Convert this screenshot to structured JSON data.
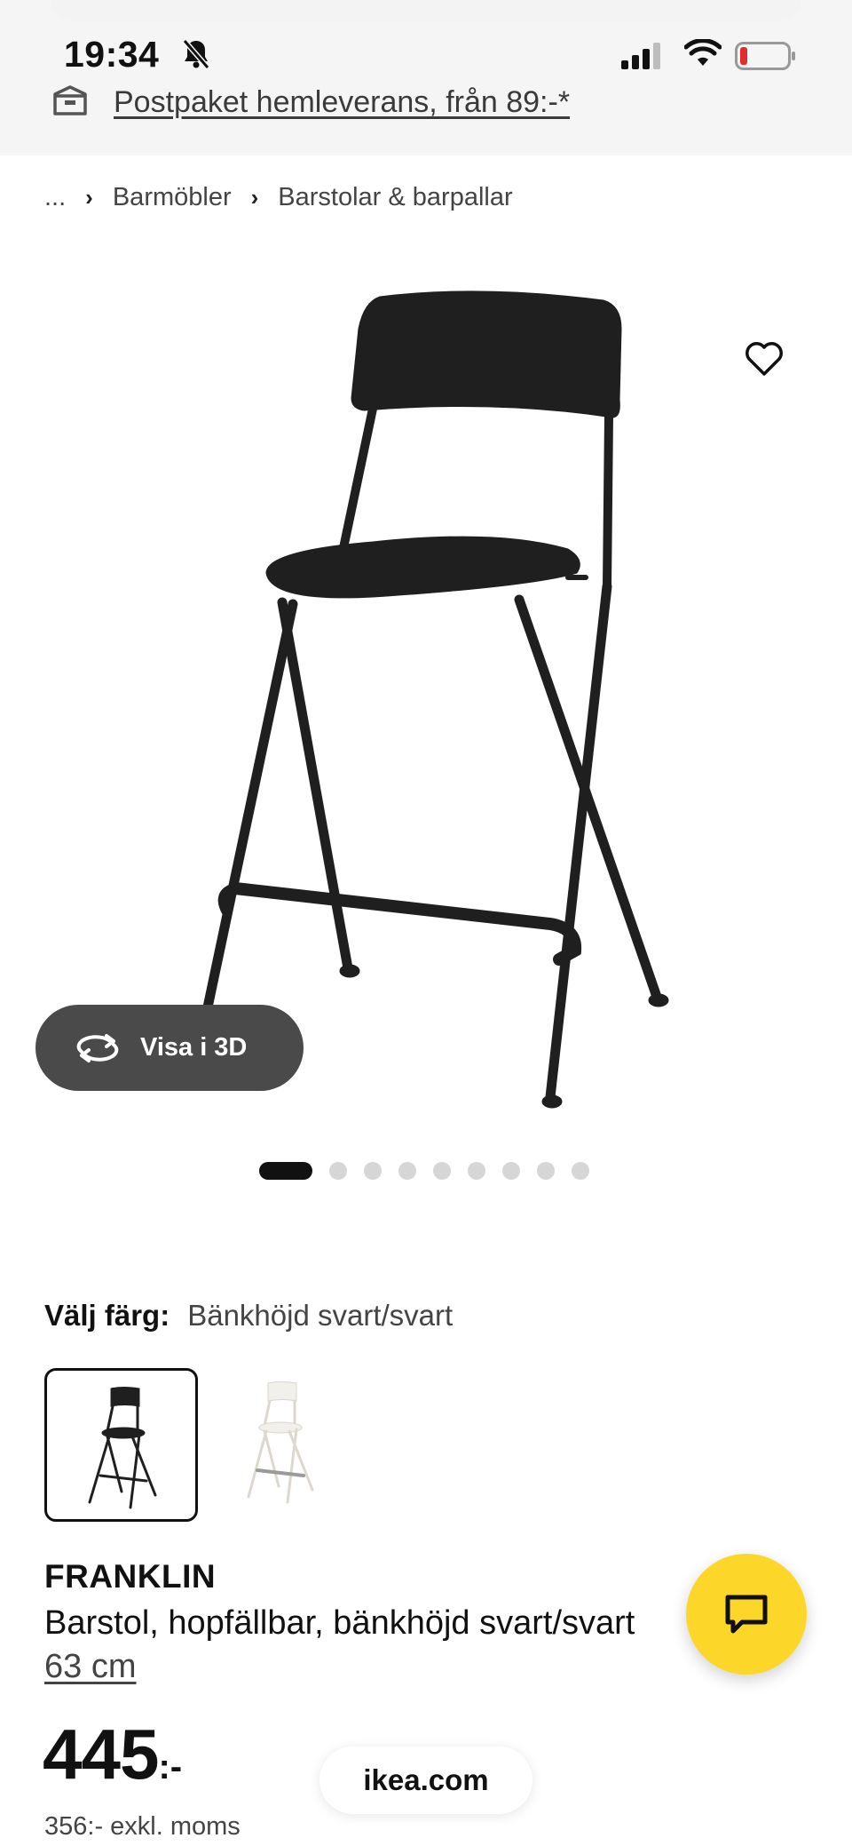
{
  "status_bar": {
    "time": "19:34"
  },
  "promo_banner": {
    "text": "Postpaket hemleverans, från 89:-*"
  },
  "breadcrumb": {
    "ellipsis": "...",
    "items": [
      "Barmöbler",
      "Barstolar & barpallar"
    ]
  },
  "gallery": {
    "view_3d_label": "Visa i 3D",
    "image_count": 9,
    "active_index": 0
  },
  "color_selector": {
    "label": "Välj färg:",
    "selected": "Bänkhöjd svart/svart",
    "options": [
      {
        "color": "#111111",
        "selected": true
      },
      {
        "color": "#f2f0ea",
        "selected": false
      }
    ]
  },
  "product": {
    "name": "FRANKLIN",
    "description": "Barstol, hopfällbar, bänkhöjd svart/svart",
    "size": "63 cm",
    "price": "445",
    "price_suffix": ":-",
    "price_ex_vat": "356:- exkl. moms"
  },
  "browser": {
    "url": "ikea.com"
  },
  "colors": {
    "accent_yellow": "#fcd72a",
    "button_dark": "#4a4a4a"
  }
}
